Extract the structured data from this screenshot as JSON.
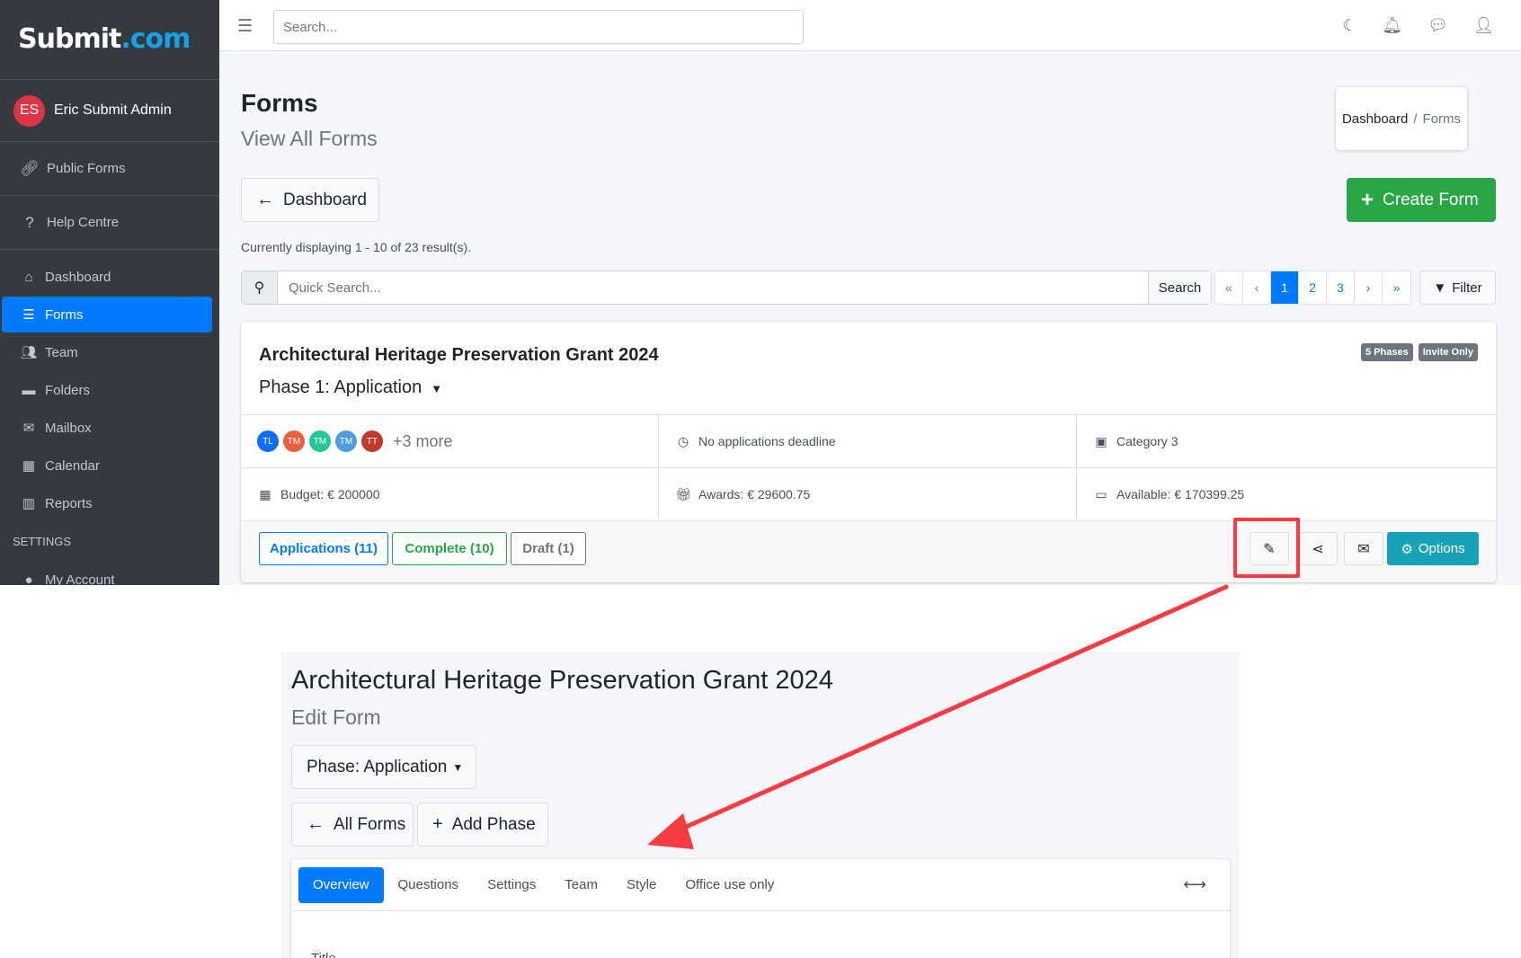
{
  "app": {
    "logo_text": "Submit",
    "logo_suffix": ".com"
  },
  "sidebar": {
    "user_initials": "ES",
    "user_name": "Eric Submit Admin",
    "public_forms": "Public Forms",
    "help_centre": "Help Centre",
    "items": [
      {
        "label": "Dashboard",
        "icon": "home-icon"
      },
      {
        "label": "Forms",
        "icon": "list-icon",
        "active": true
      },
      {
        "label": "Team",
        "icon": "users-icon"
      },
      {
        "label": "Folders",
        "icon": "folder-icon"
      },
      {
        "label": "Mailbox",
        "icon": "envelope-icon"
      },
      {
        "label": "Calendar",
        "icon": "calendar-icon"
      },
      {
        "label": "Reports",
        "icon": "chart-icon"
      }
    ],
    "settings_header": "SETTINGS",
    "my_account": "My Account"
  },
  "topbar": {
    "search_placeholder": "Search..."
  },
  "page": {
    "title": "Forms",
    "subtitle": "View All Forms",
    "breadcrumb_home": "Dashboard",
    "breadcrumb_sep": "/",
    "breadcrumb_current": "Forms",
    "dashboard_button": "Dashboard",
    "create_button": "Create Form",
    "displaying": "Currently displaying 1 - 10 of 23 result(s).",
    "quick_search_placeholder": "Quick Search...",
    "search_button": "Search",
    "pager": {
      "first": "«",
      "prev": "‹",
      "pages": [
        "1",
        "2",
        "3"
      ],
      "next": "›",
      "last": "»",
      "current": "1"
    },
    "filter_button": "Filter"
  },
  "form_card": {
    "title": "Architectural Heritage Preservation Grant 2024",
    "phase": "Phase 1: Application",
    "badges": [
      "5 Phases",
      "Invite Only"
    ],
    "team": [
      {
        "initials": "TL",
        "color": "#0d6efd"
      },
      {
        "initials": "TM",
        "color": "#e8603c"
      },
      {
        "initials": "TM",
        "color": "#20c997"
      },
      {
        "initials": "TM",
        "color": "#4d9de0"
      },
      {
        "initials": "TT",
        "color": "#c0392b"
      }
    ],
    "team_more": "+3 more",
    "deadline": "No applications deadline",
    "category": "Category 3",
    "budget": "Budget: € 200000",
    "awards": "Awards: € 29600.75",
    "available": "Available: € 170399.25",
    "applications": "Applications (11)",
    "complete": "Complete (10)",
    "draft": "Draft (1)",
    "options": "Options"
  },
  "edit_form": {
    "title": "Architectural Heritage Preservation Grant 2024",
    "subtitle": "Edit Form",
    "phase_button": "Phase: Application",
    "all_forms": "All Forms",
    "add_phase": "Add Phase",
    "tabs": [
      "Overview",
      "Questions",
      "Settings",
      "Team",
      "Style",
      "Office use only"
    ],
    "active_tab": "Overview",
    "field_label": "Title"
  },
  "colors": {
    "primary": "#007bff",
    "success": "#28a745",
    "info": "#17a2b8",
    "highlight": "#f53c43",
    "sidebar": "#343a40"
  }
}
